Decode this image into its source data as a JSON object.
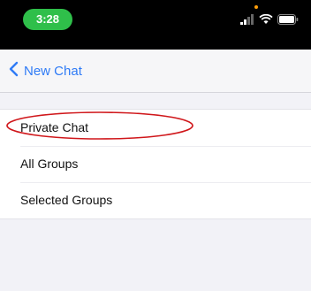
{
  "status_bar": {
    "time": "3:28",
    "icons": [
      "signal-icon",
      "wifi-icon",
      "battery-icon"
    ]
  },
  "nav": {
    "back_label": "New Chat",
    "back_icon": "chevron-left-icon"
  },
  "options": [
    {
      "label": "Private Chat"
    },
    {
      "label": "All Groups"
    },
    {
      "label": "Selected Groups"
    }
  ],
  "colors": {
    "accent": "#2f7bf6",
    "time_pill": "#2fbf4a",
    "highlight": "#d0171b",
    "background": "#f2f2f7"
  }
}
